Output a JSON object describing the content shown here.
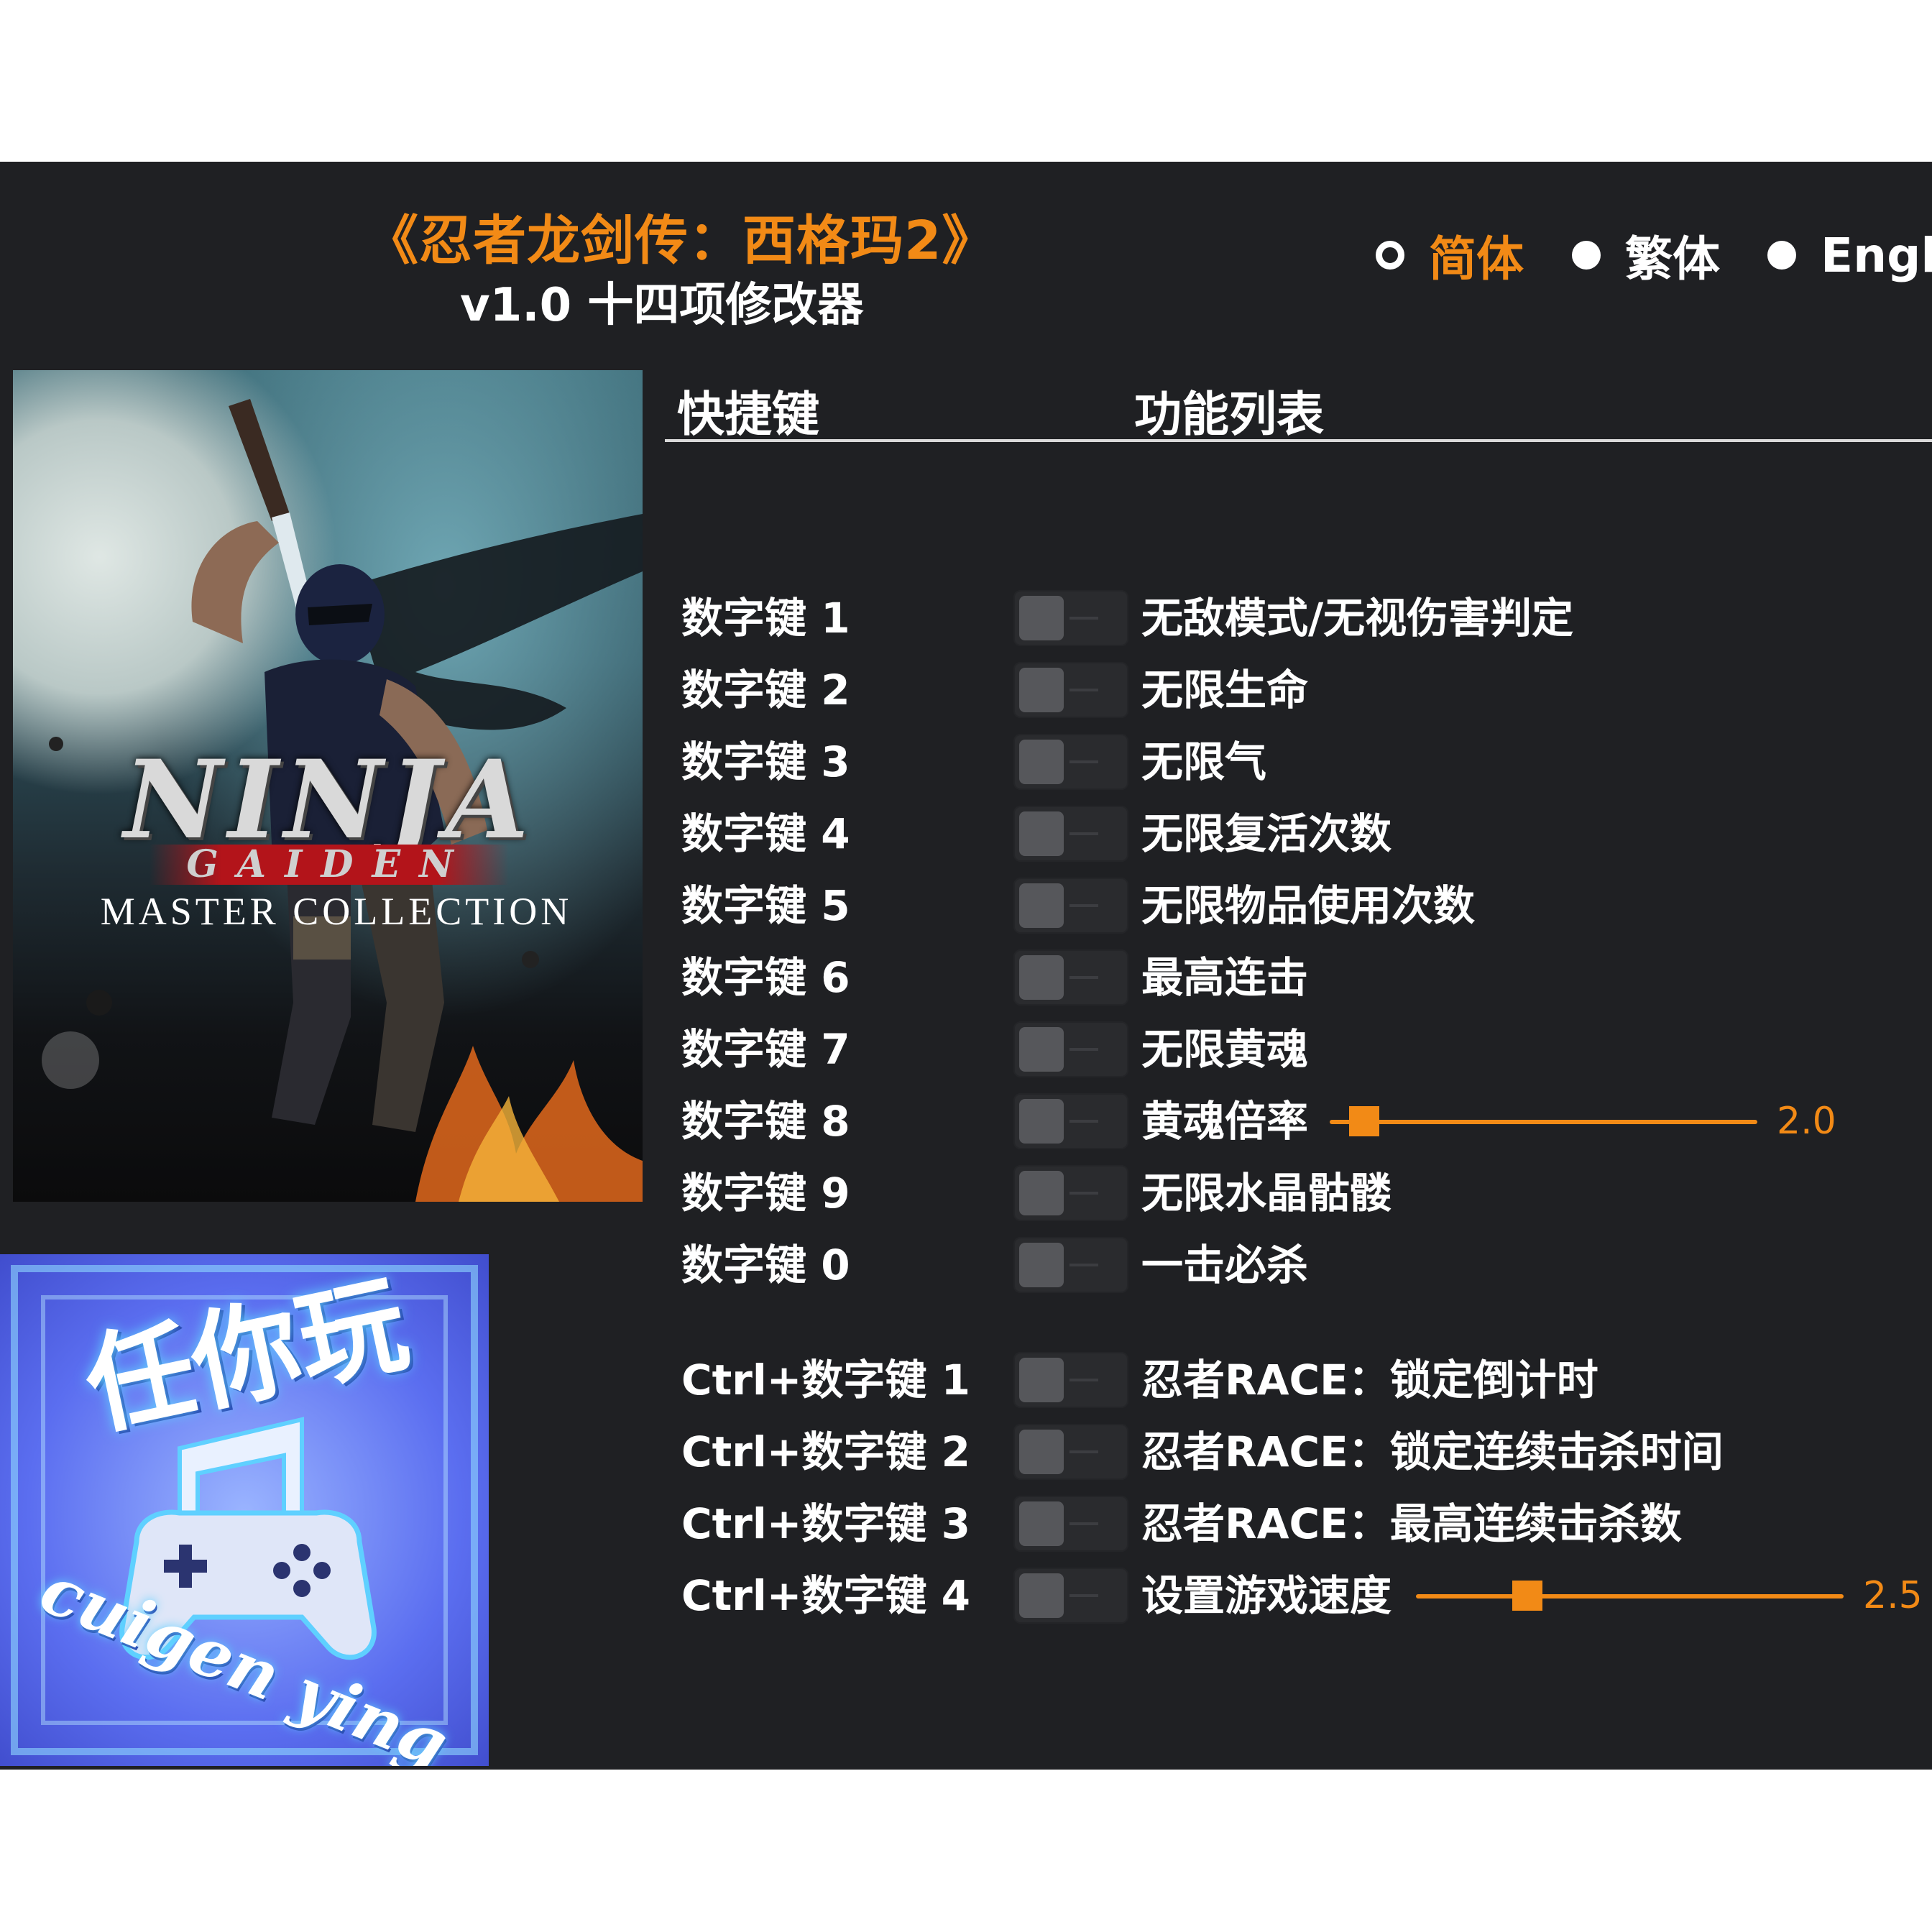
{
  "header": {
    "title": "《忍者龙剑传：西格玛2》",
    "subtitle": "v1.0 十四项修改器"
  },
  "languages": [
    {
      "label": "简体",
      "selected": true
    },
    {
      "label": "繁体",
      "selected": false
    },
    {
      "label": "Engl",
      "selected": false
    }
  ],
  "cover": {
    "logo_line1": "NINJA",
    "logo_line2": "GAIDEN",
    "logo_line3": "MASTER COLLECTION"
  },
  "badge": {
    "text_cn": "任你玩",
    "text_en": "cuigen ying"
  },
  "columns": {
    "hotkey": "快捷键",
    "function": "功能列表"
  },
  "rows": [
    {
      "hotkey": "数字键 1",
      "label": "无敌模式/无视伤害判定",
      "enabled": false
    },
    {
      "hotkey": "数字键 2",
      "label": "无限生命",
      "enabled": false
    },
    {
      "hotkey": "数字键 3",
      "label": "无限气",
      "enabled": false
    },
    {
      "hotkey": "数字键 4",
      "label": "无限复活次数",
      "enabled": false
    },
    {
      "hotkey": "数字键 5",
      "label": "无限物品使用次数",
      "enabled": false
    },
    {
      "hotkey": "数字键 6",
      "label": "最高连击",
      "enabled": false
    },
    {
      "hotkey": "数字键 7",
      "label": "无限黄魂",
      "enabled": false
    },
    {
      "hotkey": "数字键 8",
      "label": "黄魂倍率",
      "enabled": false,
      "slider": {
        "value": "2.0",
        "fraction": 0.08
      }
    },
    {
      "hotkey": "数字键 9",
      "label": "无限水晶骷髅",
      "enabled": false
    },
    {
      "hotkey": "数字键 0",
      "label": "一击必杀",
      "enabled": false
    },
    {
      "hotkey": "Ctrl+数字键 1",
      "label": "忍者RACE：锁定倒计时",
      "enabled": false
    },
    {
      "hotkey": "Ctrl+数字键 2",
      "label": "忍者RACE：锁定连续击杀时间",
      "enabled": false
    },
    {
      "hotkey": "Ctrl+数字键 3",
      "label": "忍者RACE：最高连续击杀数",
      "enabled": false
    },
    {
      "hotkey": "Ctrl+数字键 4",
      "label": "设置游戏速度",
      "enabled": false,
      "slider": {
        "value": "2.5",
        "fraction": 0.26
      }
    }
  ],
  "colors": {
    "accent": "#f28a16",
    "background": "#1f2023",
    "text": "#ffffff"
  }
}
